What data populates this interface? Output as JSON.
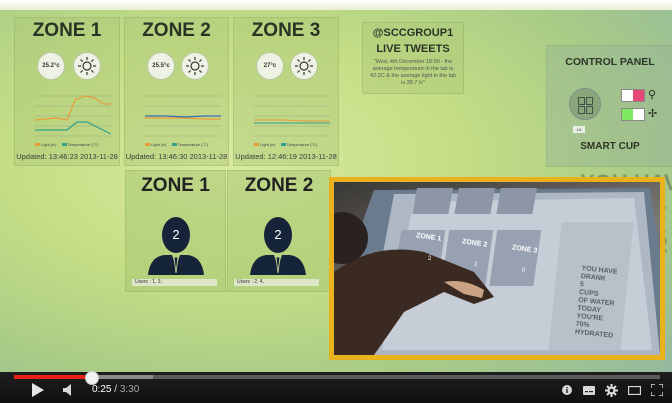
{
  "video": {
    "zones_top": [
      {
        "title": "ZONE 1",
        "temp": "25.2°c",
        "updated": "Updated: 13:46:23 2013-11-28"
      },
      {
        "title": "ZONE 2",
        "temp": "25.5°c",
        "updated": "Updated: 13:46:30 2013-11-28"
      },
      {
        "title": "ZONE 3",
        "temp": "27°c",
        "updated": "Updated: 12:46:19 2013-11-28"
      }
    ],
    "chart_legend": {
      "light": "Light (lx)",
      "temperature": "Temperature (°C)"
    },
    "tweets": {
      "handle": "@SCCGROUP1",
      "title": "LIVE TWEETS",
      "body": "\"Wed, 4th December 18:00 - the average temperature in the lab is 42.2C & the average light in the lab is 38.7 lx\""
    },
    "control_panel": {
      "title": "CONTROL PANEL",
      "smart_cup": "SMART CUP",
      "badge": "-10-"
    },
    "zones_bottom": [
      {
        "title": "ZONE 1",
        "count": "2",
        "users": "Users : 1, 3,"
      },
      {
        "title": "ZONE 2",
        "count": "2",
        "users": "Users : 2, 4,"
      }
    ],
    "ghost_text": [
      "YOU HAVE",
      "S",
      "E",
      "R",
      "ED"
    ],
    "inset": {
      "zones": [
        "ZONE 1",
        "ZONE 2",
        "ZONE 3"
      ],
      "counts": [
        "2",
        "2",
        "0"
      ],
      "side_text": [
        "YOU HAVE",
        "DRANK",
        "5",
        "CUPS",
        "OF WATER",
        "TODAY",
        "YOU'RE",
        "70%",
        "HYDRATED"
      ]
    }
  },
  "player": {
    "current_time": "0:25",
    "separator": " / ",
    "duration": "3:30",
    "progress": 0.119,
    "buffered": 0.215
  },
  "colors": {
    "accent": "#e62117",
    "inset_border": "#e9b21a",
    "control_bg": "#1b1b1b"
  }
}
